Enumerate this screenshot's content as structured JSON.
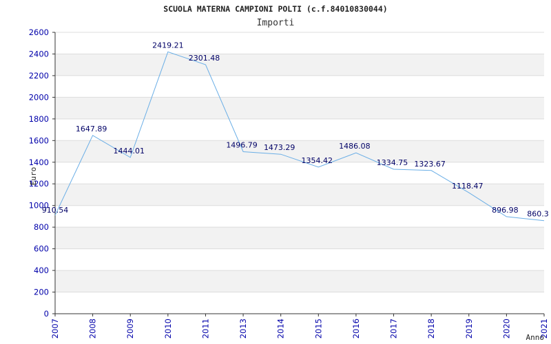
{
  "chart_data": {
    "type": "line",
    "title": "SCUOLA MATERNA CAMPIONI POLTI (c.f.84010830044)",
    "subtitle": "Importi",
    "xlabel": "Anno",
    "ylabel": "Euro",
    "categories": [
      "2007",
      "2008",
      "2009",
      "2010",
      "2011",
      "2013",
      "2014",
      "2015",
      "2016",
      "2017",
      "2018",
      "2019",
      "2020",
      "2021"
    ],
    "series": [
      {
        "values": [
          910.54,
          1647.89,
          1444.01,
          2419.21,
          2301.48,
          1496.79,
          1473.29,
          1354.42,
          1486.08,
          1334.75,
          1323.67,
          1118.47,
          896.98,
          860.3
        ]
      }
    ],
    "data_labels": [
      "910.54",
      "1647.89",
      "1444.01",
      "2419.21",
      "2301.48",
      "1496.79",
      "1473.29",
      "1354.42",
      "1486.08",
      "1334.75",
      "1323.67",
      "1118.47",
      "896.98",
      "860.3"
    ],
    "yticks": [
      "0",
      "200",
      "400",
      "600",
      "800",
      "1000",
      "1200",
      "1400",
      "1600",
      "1800",
      "2000",
      "2200",
      "2400",
      "2600"
    ],
    "ylim": [
      0,
      2600
    ],
    "grid": true,
    "legend": "none",
    "colors": {
      "line": "#6aaee6",
      "band": "#f2f2f2",
      "grid": "#dcdcdc",
      "tick_text": "#0000aa",
      "data_label": "#000066",
      "axis": "#333333"
    }
  }
}
